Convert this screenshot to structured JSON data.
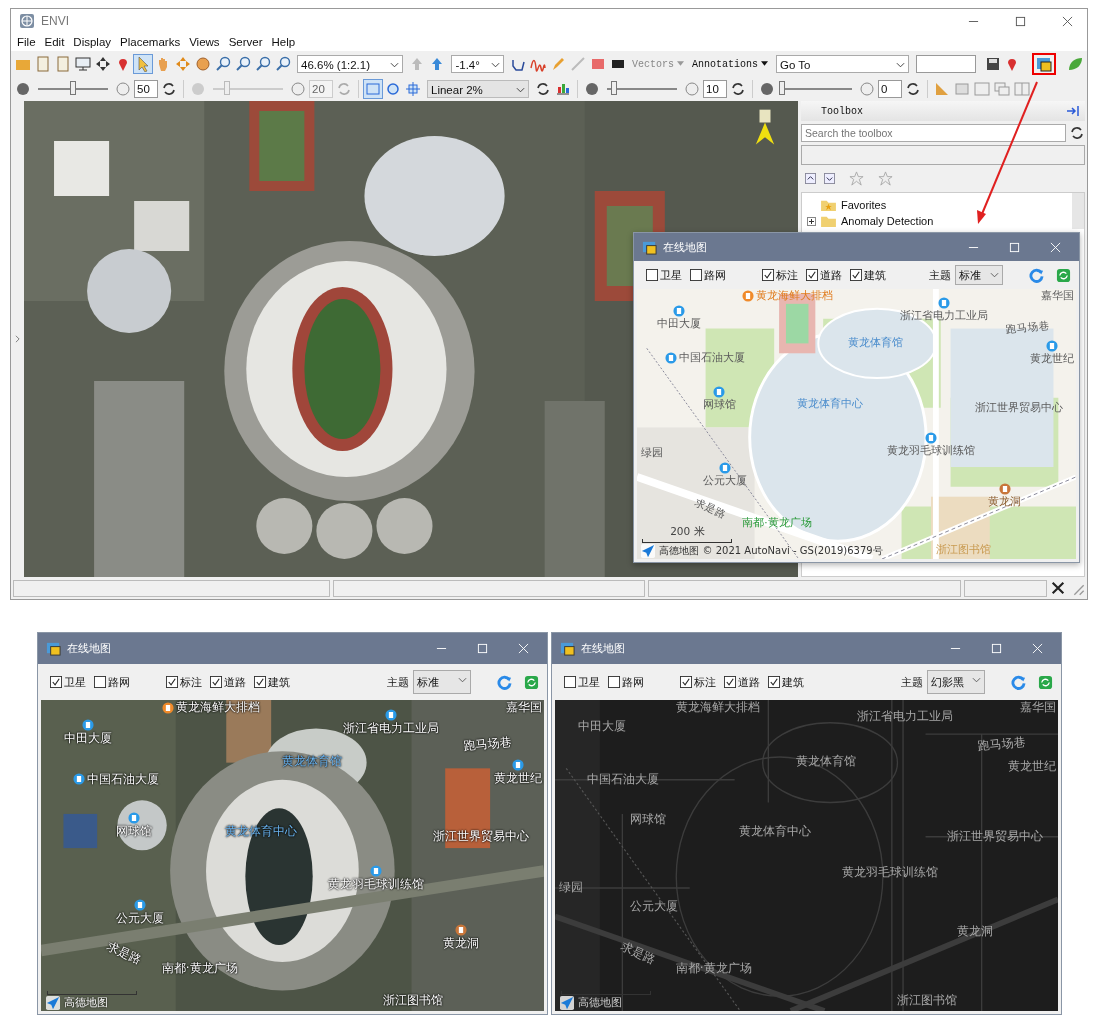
{
  "window": {
    "title": "ENVI"
  },
  "menu": [
    "File",
    "Edit",
    "Display",
    "Placemarks",
    "Views",
    "Server",
    "Help"
  ],
  "toolbar": {
    "zoom": "46.6% (1:2.1)",
    "rotation": "-1.4°",
    "vectors": {
      "label": "Vectors",
      "disabled": true
    },
    "annotations": {
      "label": "Annotations",
      "disabled": false
    },
    "goto": "Go To"
  },
  "display_bar": {
    "sliders": [
      {
        "value": "50",
        "level": 0.5,
        "disabled": false
      },
      {
        "value": "20",
        "level": 0.2,
        "disabled": true
      },
      {
        "value": "10",
        "level": 0.1,
        "disabled": false
      },
      {
        "value": "0",
        "level": 0,
        "disabled": false
      }
    ],
    "stretch": "Linear 2%"
  },
  "toolbox": {
    "title": "Toolbox",
    "search_placeholder": "Search the toolbox",
    "tree": [
      {
        "label": "Favorites",
        "kind": "favorites"
      },
      {
        "label": "Anomaly Detection",
        "kind": "folder"
      }
    ]
  },
  "map_windows": [
    {
      "title": "在线地图",
      "kind": "standard",
      "theme_label": "主题",
      "theme": "标准",
      "options": [
        {
          "label": "卫星",
          "checked": false
        },
        {
          "label": "路网",
          "checked": false
        },
        {
          "label": "标注",
          "checked": true
        },
        {
          "label": "道路",
          "checked": true
        },
        {
          "label": "建筑",
          "checked": true
        }
      ],
      "labels": [
        "黄龙海鲜大排档",
        "中田大厦",
        "浙江省电力工业局",
        "嘉华国",
        "跑马场巷",
        "黄龙体育馆",
        "中国石油大厦",
        "黄龙世纪",
        "网球馆",
        "黄龙体育中心",
        "浙江世界贸易中心",
        "黄龙羽毛球训练馆",
        "公元大厦",
        "黄龙洞",
        "求是路",
        "南都·黄龙广场",
        "浙江图书馆",
        "绿园"
      ],
      "scale": "200 米",
      "attribution": "高德地图 © 2021 AutoNavi - GS(2019)6379号"
    },
    {
      "title": "在线地图",
      "kind": "satellite",
      "theme_label": "主题",
      "theme": "标准",
      "options": [
        {
          "label": "卫星",
          "checked": true
        },
        {
          "label": "路网",
          "checked": false
        },
        {
          "label": "标注",
          "checked": true
        },
        {
          "label": "道路",
          "checked": true
        },
        {
          "label": "建筑",
          "checked": true
        }
      ],
      "labels": [
        "黄龙海鲜大排档",
        "中田大厦",
        "浙江省电力工业局",
        "嘉华国",
        "跑马场巷",
        "黄龙体育馆",
        "中国石油大厦",
        "黄龙世纪",
        "网球馆",
        "黄龙体育中心",
        "浙江世界贸易中心",
        "黄龙羽毛球训练馆",
        "公元大厦",
        "黄龙洞",
        "求是路",
        "南都·黄龙广场",
        "浙江图书馆"
      ],
      "attribution": "高德地图"
    },
    {
      "title": "在线地图",
      "kind": "dark",
      "theme_label": "主题",
      "theme": "幻影黑",
      "options": [
        {
          "label": "卫星",
          "checked": false
        },
        {
          "label": "路网",
          "checked": false
        },
        {
          "label": "标注",
          "checked": true
        },
        {
          "label": "道路",
          "checked": true
        },
        {
          "label": "建筑",
          "checked": true
        }
      ],
      "labels": [
        "黄龙海鲜大排档",
        "中田大厦",
        "浙江省电力工业局",
        "嘉华国",
        "跑马场巷",
        "黄龙体育馆",
        "中国石油大厦",
        "黄龙世纪",
        "网球馆",
        "黄龙体育中心",
        "浙江世界贸易中心",
        "黄龙羽毛球训练馆",
        "公元大厦",
        "黄龙洞",
        "求是路",
        "南都·黄龙广场",
        "浙江图书馆",
        "绿园"
      ],
      "attribution": "高德地图"
    }
  ]
}
